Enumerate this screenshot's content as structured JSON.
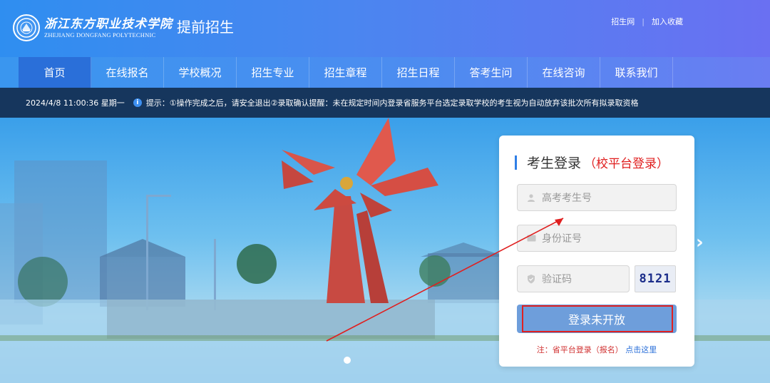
{
  "header": {
    "logo_cn": "浙江东方职业技术学院",
    "logo_en": "ZHEJIANG DONGFANG POLYTECHNIC",
    "subtitle": "提前招生",
    "links": [
      "招生网",
      "加入收藏"
    ]
  },
  "nav": {
    "items": [
      "首页",
      "在线报名",
      "学校概况",
      "招生专业",
      "招生章程",
      "招生日程",
      "答考生问",
      "在线咨询",
      "联系我们"
    ],
    "active": "首页"
  },
  "notice": {
    "datetime": "2024/4/8 11:00:36 星期一",
    "text": "提示：①操作完成之后，请安全退出②录取确认提醒：未在规定时间内登录省服务平台选定录取学校的考生视为自动放弃该批次所有拟录取资格"
  },
  "login": {
    "title": "考生登录",
    "title_note": "（校平台登录）",
    "exam_id_placeholder": "高考考生号",
    "id_card_placeholder": "身份证号",
    "captcha_placeholder": "验证码",
    "captcha_value": "8121",
    "submit_label": "登录未开放",
    "footer_note": "注：省平台登录（报名）",
    "footer_link": "点击这里"
  },
  "colors": {
    "accent": "#2f7fe6",
    "nav_active": "#2a6fd9",
    "highlight_red": "#e02020",
    "button": "#6e9edb"
  },
  "icons": {
    "user": "user-icon",
    "idcard": "id-card-icon",
    "shield": "shield-icon",
    "info": "info-icon",
    "next": "chevron-right-icon"
  }
}
